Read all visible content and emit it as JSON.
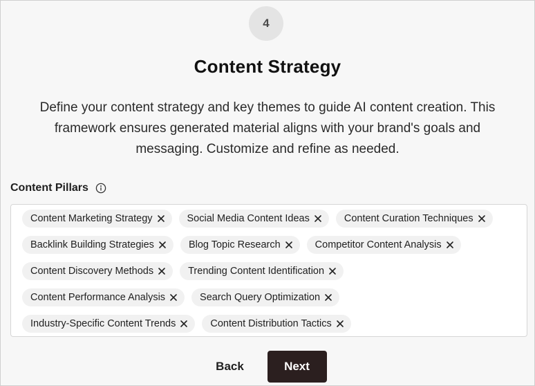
{
  "step": {
    "number": "4"
  },
  "header": {
    "title": "Content Strategy",
    "description": "Define your content strategy and key themes to guide AI content creation. This framework ensures generated material aligns with your brand's goals and messaging. Customize and refine as needed."
  },
  "pillars": {
    "label": "Content Pillars",
    "info_icon": "info-icon",
    "remove_icon": "close-icon",
    "rows": [
      [
        "Content Marketing Strategy",
        "Social Media Content Ideas",
        "Content Curation Techniques"
      ],
      [
        "Backlink Building Strategies",
        "Blog Topic Research",
        "Competitor Content Analysis"
      ],
      [
        "Content Discovery Methods",
        "Trending Content Identification"
      ],
      [
        "Content Performance Analysis",
        "Search Query Optimization"
      ],
      [
        "Industry-Specific Content Trends",
        "Content Distribution Tactics"
      ]
    ]
  },
  "actions": {
    "back_label": "Back",
    "next_label": "Next"
  },
  "colors": {
    "next_button_bg": "#2b1f1f",
    "pill_bg": "#f1f1f1",
    "page_bg": "#f7f7f7"
  }
}
